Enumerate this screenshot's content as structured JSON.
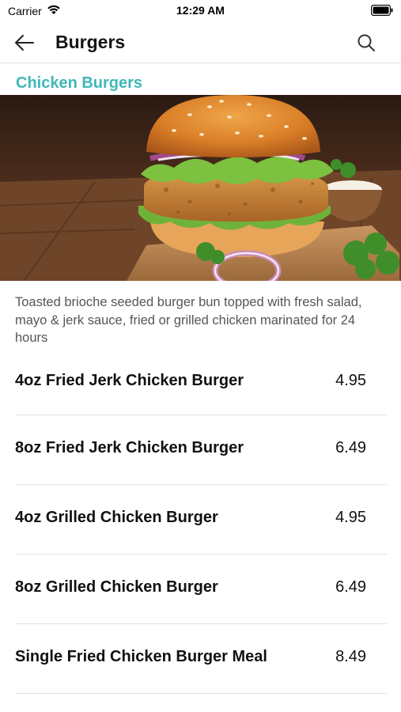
{
  "status": {
    "carrier": "Carrier",
    "time": "12:29 AM"
  },
  "nav": {
    "title": "Burgers"
  },
  "section": {
    "title": "Chicken Burgers"
  },
  "hero": {
    "alt": "Chicken burger photo"
  },
  "description": "Toasted brioche seeded burger bun topped with fresh salad, mayo & jerk sauce, fried or grilled chicken marinated for 24 hours",
  "items": [
    {
      "name": "4oz Fried Jerk Chicken Burger",
      "price": "4.95"
    },
    {
      "name": "8oz Fried Jerk Chicken Burger",
      "price": "6.49"
    },
    {
      "name": "4oz Grilled Chicken Burger",
      "price": "4.95"
    },
    {
      "name": "8oz Grilled Chicken Burger",
      "price": "6.49"
    },
    {
      "name": "Single Fried Chicken Burger Meal",
      "price": "8.49"
    }
  ],
  "colors": {
    "accent": "#3fb8b5",
    "text": "#111111",
    "muted": "#555555",
    "divider": "#e2e2e2"
  },
  "icons": {
    "back": "arrow-left-icon",
    "search": "search-icon",
    "wifi": "wifi-icon",
    "battery": "battery-icon"
  }
}
